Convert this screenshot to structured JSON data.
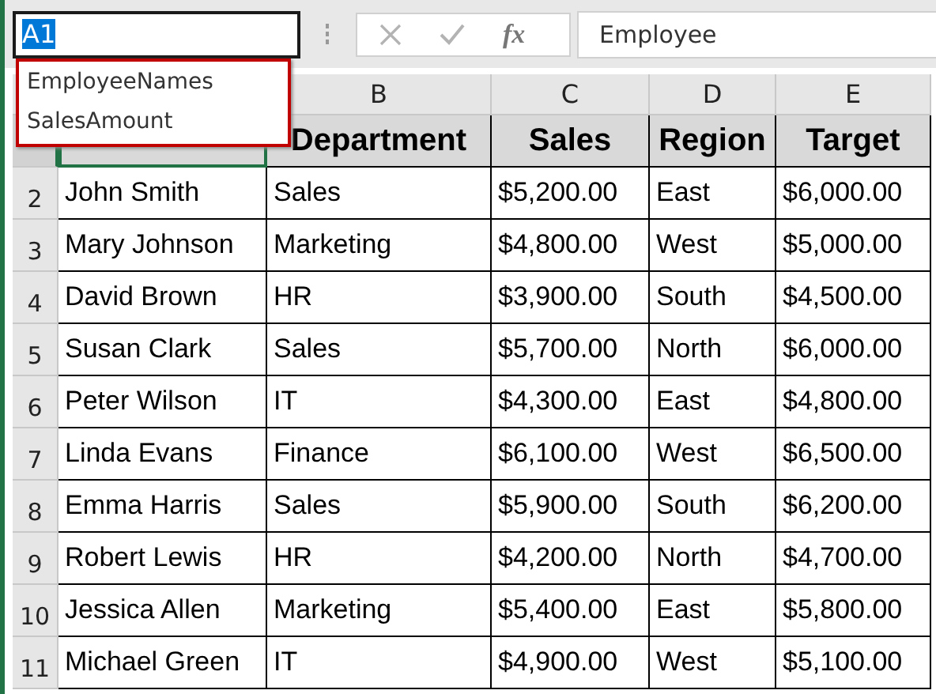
{
  "name_box": {
    "value": "A1",
    "text_selected": true
  },
  "name_list": {
    "items": [
      "EmployeeNames",
      "SalesAmount"
    ]
  },
  "formula_bar": {
    "function_label": "fx",
    "value": "Employee"
  },
  "columns": [
    "B",
    "C",
    "D",
    "E"
  ],
  "rows": [
    {
      "selected": true,
      "kind": "header",
      "cells": [
        "Department",
        "Sales",
        "Region",
        "Target"
      ]
    },
    {
      "number": "2",
      "selected": false,
      "kind": "data",
      "cells": [
        "John Smith",
        "Sales",
        "$5,200.00",
        "East",
        "$6,000.00"
      ]
    },
    {
      "number": "3",
      "selected": false,
      "kind": "data",
      "cells": [
        "Mary Johnson",
        "Marketing",
        "$4,800.00",
        "West",
        "$5,000.00"
      ]
    },
    {
      "number": "4",
      "selected": false,
      "kind": "data",
      "cells": [
        "David Brown",
        "HR",
        "$3,900.00",
        "South",
        "$4,500.00"
      ]
    },
    {
      "number": "5",
      "selected": false,
      "kind": "data",
      "cells": [
        "Susan Clark",
        "Sales",
        "$5,700.00",
        "North",
        "$6,000.00"
      ]
    },
    {
      "number": "6",
      "selected": false,
      "kind": "data",
      "cells": [
        "Peter Wilson",
        "IT",
        "$4,300.00",
        "East",
        "$4,800.00"
      ]
    },
    {
      "number": "7",
      "selected": false,
      "kind": "data",
      "cells": [
        "Linda Evans",
        "Finance",
        "$6,100.00",
        "West",
        "$6,500.00"
      ]
    },
    {
      "number": "8",
      "selected": false,
      "kind": "data",
      "cells": [
        "Emma Harris",
        "Sales",
        "$5,900.00",
        "South",
        "$6,200.00"
      ]
    },
    {
      "number": "9",
      "selected": false,
      "kind": "data",
      "cells": [
        "Robert Lewis",
        "HR",
        "$4,200.00",
        "North",
        "$4,700.00"
      ]
    },
    {
      "number": "10",
      "selected": false,
      "kind": "data",
      "cells": [
        "Jessica Allen",
        "Marketing",
        "$5,400.00",
        "East",
        "$5,800.00"
      ]
    },
    {
      "number": "11",
      "selected": false,
      "kind": "data",
      "cells": [
        "Michael Green",
        "IT",
        "$4,900.00",
        "West",
        "$5,100.00"
      ]
    }
  ]
}
